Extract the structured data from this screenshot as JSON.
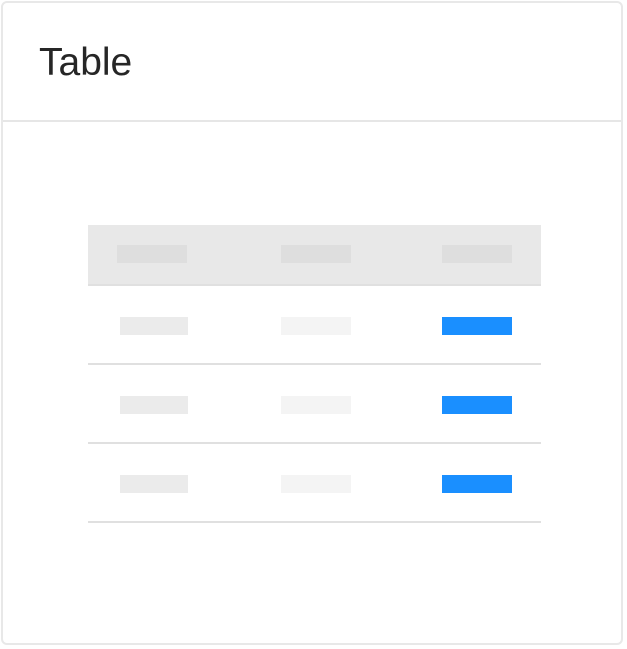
{
  "card": {
    "title": "Table"
  },
  "colors": {
    "header_background": "#e8e8e8",
    "placeholder_light": "#ebebeb",
    "placeholder_lighter": "#f4f4f4",
    "accent": "#1a8fff",
    "divider": "#e0e0e0"
  },
  "table": {
    "columns": 3,
    "rows": 3,
    "header_placeholders": [
      "placeholder",
      "placeholder",
      "placeholder"
    ],
    "row_placeholder_styles": [
      "light",
      "lighter",
      "accent"
    ]
  }
}
